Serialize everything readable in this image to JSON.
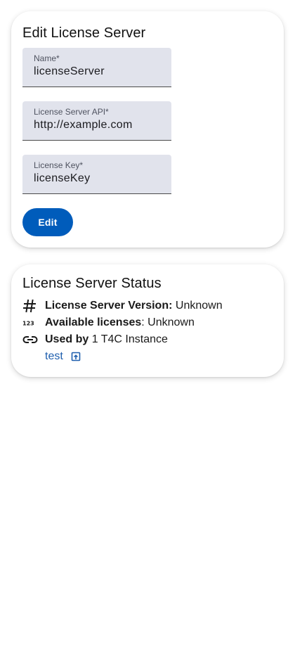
{
  "edit_card": {
    "title": "Edit License Server",
    "fields": {
      "name": {
        "label": "Name*",
        "value": "licenseServer"
      },
      "api": {
        "label": "License Server API*",
        "value": "http://example.com"
      },
      "key": {
        "label": "License Key*",
        "value": "licenseKey"
      }
    },
    "edit_button_label": "Edit"
  },
  "status_card": {
    "title": "License Server Status",
    "version": {
      "icon": "hash-icon",
      "label": "License Server Version:",
      "value": "Unknown"
    },
    "licenses": {
      "icon": "numbers-123-icon",
      "label": "Available licenses",
      "separator": ":",
      "value": "Unknown"
    },
    "used_by": {
      "icon": "link-icon",
      "label": "Used by",
      "value": "1 T4C Instance"
    },
    "instances": [
      {
        "name": "test",
        "icon": "open-in-new-icon"
      }
    ]
  },
  "colors": {
    "accent": "#005cbb",
    "link": "#1f5fae",
    "field_bg": "#e1e3ec"
  }
}
